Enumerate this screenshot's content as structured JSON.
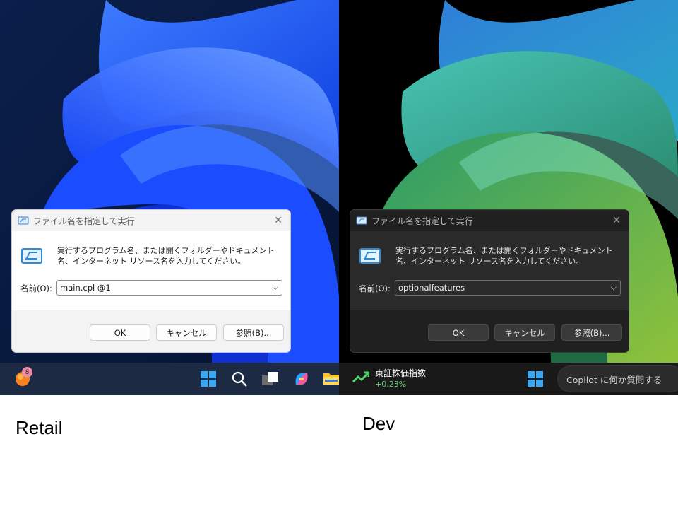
{
  "left": {
    "caption": "Retail",
    "dialog": {
      "title": "ファイル名を指定して実行",
      "description": "実行するプログラム名、または開くフォルダーやドキュメント名、インターネット リソース名を入力してください。",
      "name_label": "名前(O):",
      "name_value": "main.cpl @1",
      "ok_label": "OK",
      "cancel_label": "キャンセル",
      "browse_label": "参照(B)..."
    },
    "taskbar": {
      "widget_badge": "8",
      "items": [
        "start-icon",
        "search-icon",
        "task-view-icon",
        "copilot-icon",
        "file-explorer-icon"
      ]
    }
  },
  "right": {
    "caption": "Dev",
    "dialog": {
      "title": "ファイル名を指定して実行",
      "description": "実行するプログラム名、または開くフォルダーやドキュメント名、インターネット リソース名を入力してください。",
      "name_label": "名前(O):",
      "name_value": "optionalfeatures",
      "ok_label": "OK",
      "cancel_label": "キャンセル",
      "browse_label": "参照(B)..."
    },
    "taskbar": {
      "stock_name": "東証株価指数",
      "stock_change": "+0.23%",
      "copilot_placeholder": "Copilot に何か質問する",
      "items": [
        "stock-trend-icon",
        "start-icon"
      ]
    }
  },
  "colors": {
    "retail_wallpaper_bg": "#0a1a3c",
    "retail_bloom": "#1f5cff",
    "dev_wallpaper_bg": "#000000",
    "dev_bloom_teal": "#3fb8a8",
    "dev_bloom_green": "#2f9d57",
    "stock_positive": "#5fd47a"
  }
}
